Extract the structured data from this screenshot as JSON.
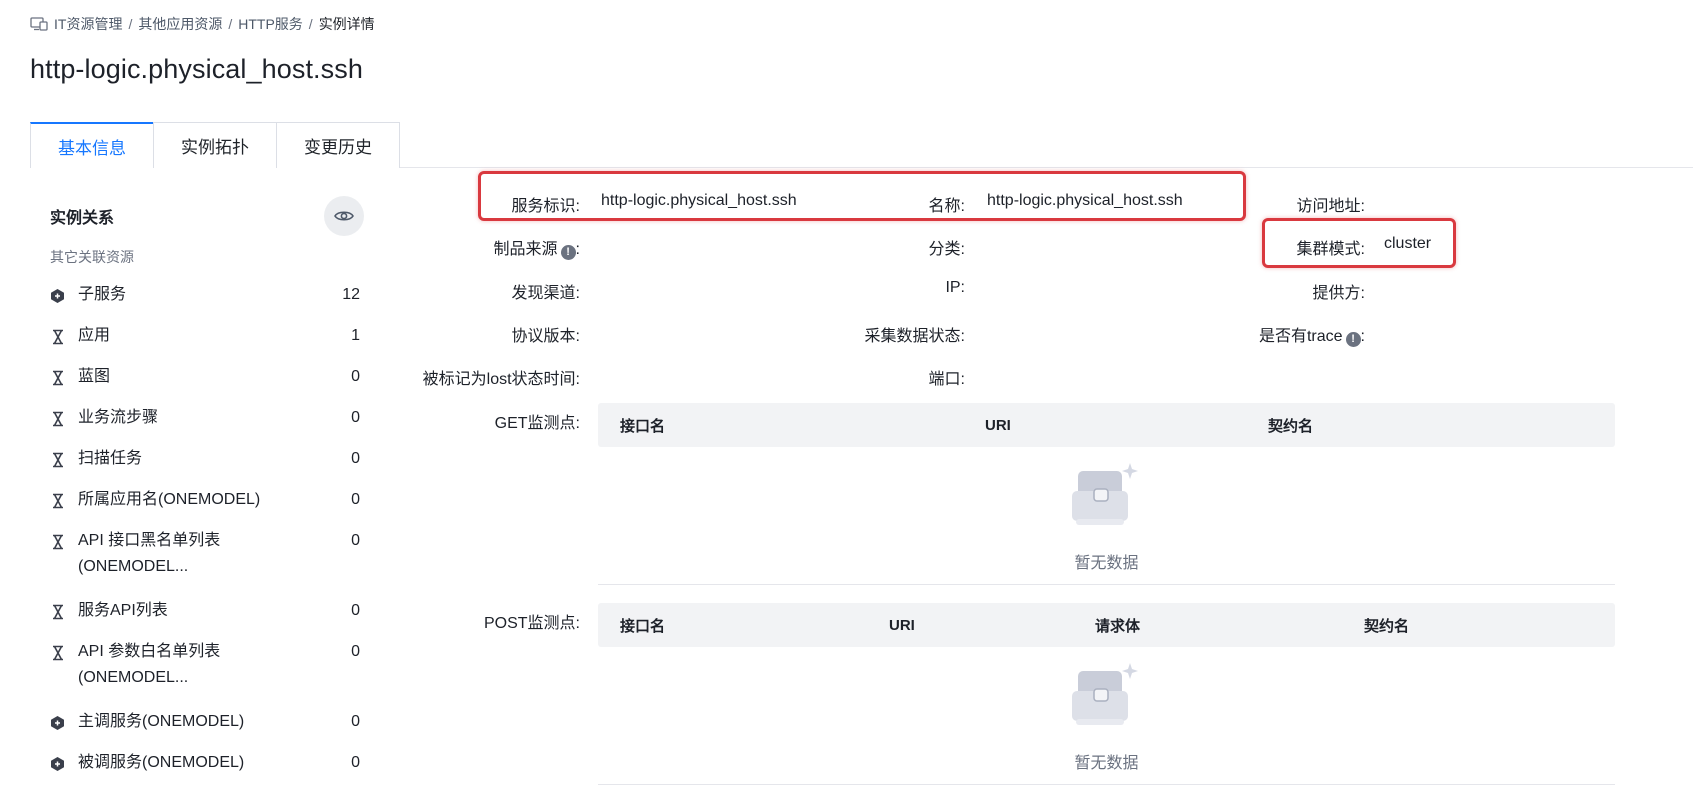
{
  "breadcrumb": {
    "items": [
      "IT资源管理",
      "其他应用资源",
      "HTTP服务"
    ],
    "current": "实例详情",
    "separator": "/"
  },
  "page_title": "http-logic.physical_host.ssh",
  "tabs": [
    {
      "label": "基本信息",
      "active": true
    },
    {
      "label": "实例拓扑",
      "active": false
    },
    {
      "label": "变更历史",
      "active": false
    }
  ],
  "sidebar": {
    "title": "实例关系",
    "subtitle": "其它关联资源",
    "items": [
      {
        "icon": "hexagon-icon",
        "label": "子服务",
        "count": "12"
      },
      {
        "icon": "hourglass-icon",
        "label": "应用",
        "count": "1"
      },
      {
        "icon": "hourglass-icon",
        "label": "蓝图",
        "count": "0"
      },
      {
        "icon": "hourglass-icon",
        "label": "业务流步骤",
        "count": "0"
      },
      {
        "icon": "hourglass-icon",
        "label": "扫描任务",
        "count": "0"
      },
      {
        "icon": "hourglass-icon",
        "label": "所属应用名(ONEMODEL)",
        "count": "0"
      },
      {
        "icon": "hourglass-icon",
        "label": "API 接口黑名单列表",
        "label2": "(ONEMODEL...",
        "count": "0"
      },
      {
        "icon": "hourglass-icon",
        "label": "服务API列表",
        "count": "0"
      },
      {
        "icon": "hourglass-icon",
        "label": "API 参数白名单列表",
        "label2": "(ONEMODEL...",
        "count": "0"
      },
      {
        "icon": "hexagon-icon",
        "label": "主调服务(ONEMODEL)",
        "count": "0"
      },
      {
        "icon": "hexagon-icon",
        "label": "被调服务(ONEMODEL)",
        "count": "0"
      }
    ]
  },
  "details": {
    "service_id": {
      "label": "服务标识:",
      "value": "http-logic.physical_host.ssh"
    },
    "name": {
      "label": "名称:",
      "value": "http-logic.physical_host.ssh"
    },
    "access_address": {
      "label": "访问地址:",
      "value": ""
    },
    "product_source": {
      "label": "制品来源",
      "suffix": ":",
      "value": ""
    },
    "category": {
      "label": "分类:",
      "value": ""
    },
    "cluster_mode": {
      "label": "集群模式:",
      "value": "cluster"
    },
    "discovery_channel": {
      "label": "发现渠道:",
      "value": ""
    },
    "ip": {
      "label": "IP:",
      "value": ""
    },
    "provider": {
      "label": "提供方:",
      "value": ""
    },
    "protocol_version": {
      "label": "协议版本:",
      "value": ""
    },
    "collect_status": {
      "label": "采集数据状态:",
      "value": ""
    },
    "has_trace": {
      "label": "是否有trace",
      "suffix": ":",
      "value": ""
    },
    "lost_time": {
      "label": "被标记为lost状态时间:",
      "value": ""
    },
    "port": {
      "label": "端口:",
      "value": ""
    }
  },
  "get_monitor": {
    "label": "GET监测点:",
    "columns": [
      "接口名",
      "URI",
      "契约名"
    ],
    "empty_text": "暂无数据"
  },
  "post_monitor": {
    "label": "POST监测点:",
    "columns": [
      "接口名",
      "URI",
      "请求体",
      "契约名"
    ],
    "empty_text": "暂无数据"
  },
  "colors": {
    "accent": "#1677ff",
    "highlight": "#d9393f",
    "text": "#1d2129",
    "muted": "#6b7280"
  }
}
